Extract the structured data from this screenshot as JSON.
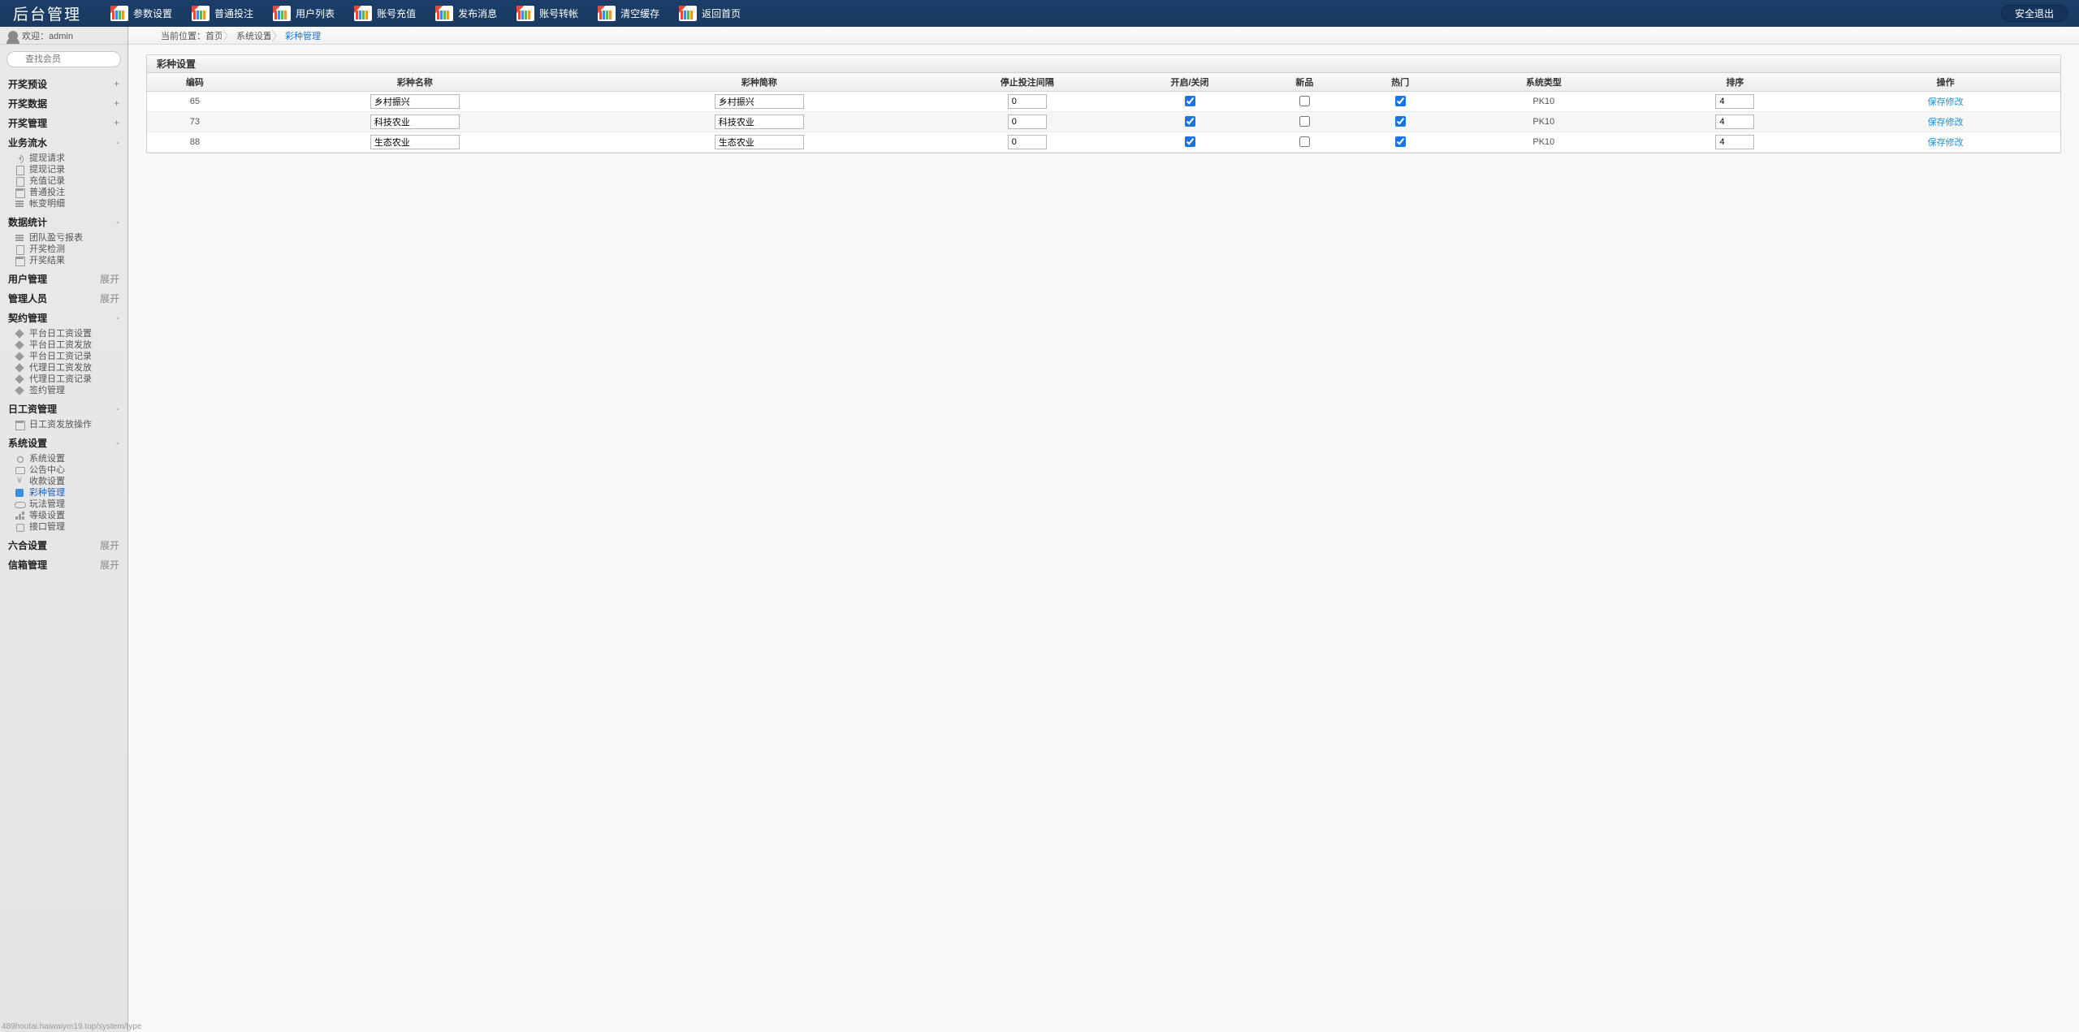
{
  "brand": "后台管理",
  "logout_label": "安全退出",
  "topnav": [
    {
      "label": "参数设置"
    },
    {
      "label": "普通投注"
    },
    {
      "label": "用户列表"
    },
    {
      "label": "账号充值"
    },
    {
      "label": "发布消息"
    },
    {
      "label": "账号转帐"
    },
    {
      "label": "清空缓存"
    },
    {
      "label": "返回首页"
    }
  ],
  "welcome_prefix": "欢迎：",
  "welcome_user": "admin",
  "search_placeholder": "查找会员",
  "sidebar": [
    {
      "title": "开奖预设",
      "toggle": "+",
      "items": []
    },
    {
      "title": "开奖数据",
      "toggle": "+",
      "items": []
    },
    {
      "title": "开奖管理",
      "toggle": "+",
      "items": []
    },
    {
      "title": "业务流水",
      "toggle": "-",
      "items": [
        {
          "label": "提现请求",
          "icon": "i-sound"
        },
        {
          "label": "提现记录",
          "icon": "i-doc"
        },
        {
          "label": "充值记录",
          "icon": "i-doc"
        },
        {
          "label": "普通投注",
          "icon": "i-cal"
        },
        {
          "label": "帐变明细",
          "icon": "i-list"
        }
      ]
    },
    {
      "title": "数据统计",
      "toggle": "-",
      "items": [
        {
          "label": "团队盈亏报表",
          "icon": "i-list"
        },
        {
          "label": "开奖检测",
          "icon": "i-doc"
        },
        {
          "label": "开奖结果",
          "icon": "i-cal"
        }
      ]
    },
    {
      "title": "用户管理",
      "toggle": "展开",
      "items": []
    },
    {
      "title": "管理人员",
      "toggle": "展开",
      "items": []
    },
    {
      "title": "契约管理",
      "toggle": "-",
      "items": [
        {
          "label": "平台日工资设置",
          "icon": "i-tag"
        },
        {
          "label": "平台日工资发放",
          "icon": "i-tag"
        },
        {
          "label": "平台日工资记录",
          "icon": "i-tag"
        },
        {
          "label": "代理日工资发放",
          "icon": "i-tag"
        },
        {
          "label": "代理日工资记录",
          "icon": "i-tag"
        },
        {
          "label": "签约管理",
          "icon": "i-tag"
        }
      ]
    },
    {
      "title": "日工资管理",
      "toggle": "-",
      "items": [
        {
          "label": "日工资发放操作",
          "icon": "i-cal"
        }
      ]
    },
    {
      "title": "系统设置",
      "toggle": "-",
      "items": [
        {
          "label": "系统设置",
          "icon": "i-cog"
        },
        {
          "label": "公告中心",
          "icon": "i-msg"
        },
        {
          "label": "收款设置",
          "icon": "i-money"
        },
        {
          "label": "彩种管理",
          "icon": "i-color",
          "active": true
        },
        {
          "label": "玩法管理",
          "icon": "i-game"
        },
        {
          "label": "等级设置",
          "icon": "i-level"
        },
        {
          "label": "接口管理",
          "icon": "i-api"
        }
      ]
    },
    {
      "title": "六合设置",
      "toggle": "展开",
      "items": []
    },
    {
      "title": "信箱管理",
      "toggle": "展开",
      "items": []
    }
  ],
  "breadcrumb": {
    "label": "当前位置：",
    "items": [
      "首页",
      "系统设置",
      "彩种管理"
    ]
  },
  "panel_title": "彩种设置",
  "columns": [
    "编码",
    "彩种名称",
    "彩种简称",
    "停止投注间隔",
    "开启/关闭",
    "新品",
    "热门",
    "系统类型",
    "排序",
    "操作"
  ],
  "rows": [
    {
      "code": "65",
      "name": "乡村振兴",
      "short": "乡村振兴",
      "stop": "0",
      "open": true,
      "new": false,
      "hot": true,
      "sys": "PK10",
      "sort": "4",
      "op": "保存修改"
    },
    {
      "code": "73",
      "name": "科技农业",
      "short": "科技农业",
      "stop": "0",
      "open": true,
      "new": false,
      "hot": true,
      "sys": "PK10",
      "sort": "4",
      "op": "保存修改"
    },
    {
      "code": "88",
      "name": "生态农业",
      "short": "生态农业",
      "stop": "0",
      "open": true,
      "new": false,
      "hot": true,
      "sys": "PK10",
      "sort": "4",
      "op": "保存修改"
    }
  ],
  "footer_url": "489houtai.haiwaiym19.top/system/type"
}
